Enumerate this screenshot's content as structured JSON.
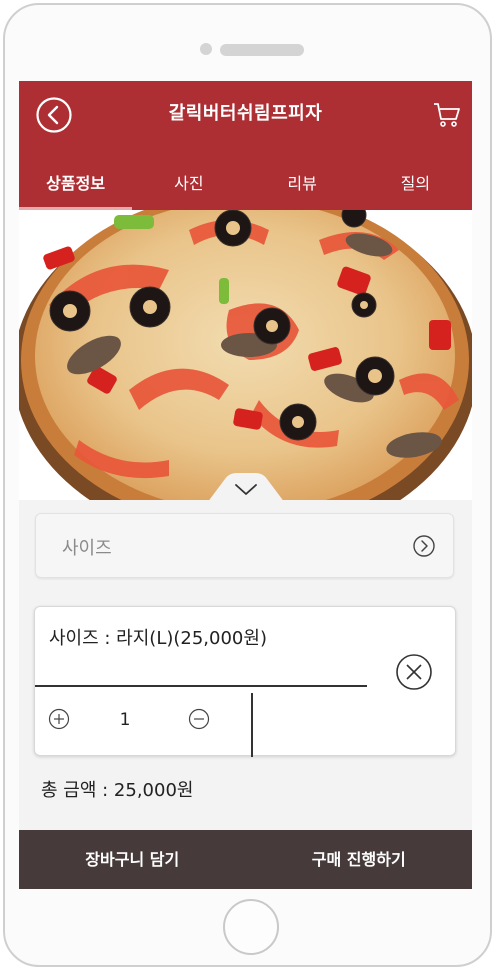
{
  "header": {
    "title": "갈릭버터쉬림프피자",
    "back_icon": "circle-chevron-left-icon",
    "cart_icon": "shopping-cart-icon"
  },
  "tabs": [
    {
      "label": "상품정보",
      "active": true
    },
    {
      "label": "사진",
      "active": false
    },
    {
      "label": "리뷰",
      "active": false
    },
    {
      "label": "질의",
      "active": false
    }
  ],
  "product_image": {
    "icon": "pizza-photo"
  },
  "size_selector": {
    "label": "사이즈",
    "icon": "circle-chevron-right-icon"
  },
  "selected_option": {
    "text": "사이즈 : 라지(L)(25,000원)",
    "quantity": "1",
    "plus_icon": "circle-plus-icon",
    "minus_icon": "circle-minus-icon",
    "remove_icon": "circle-x-icon"
  },
  "total": {
    "text": "총 금액 : 25,000원"
  },
  "bottom_bar": {
    "cart_button": "장바구니 담기",
    "buy_button": "구매 진행하기"
  },
  "colors": {
    "brand": "#ad2f33",
    "bottom_bar": "#463a3a",
    "background": "#f3f3f3"
  }
}
